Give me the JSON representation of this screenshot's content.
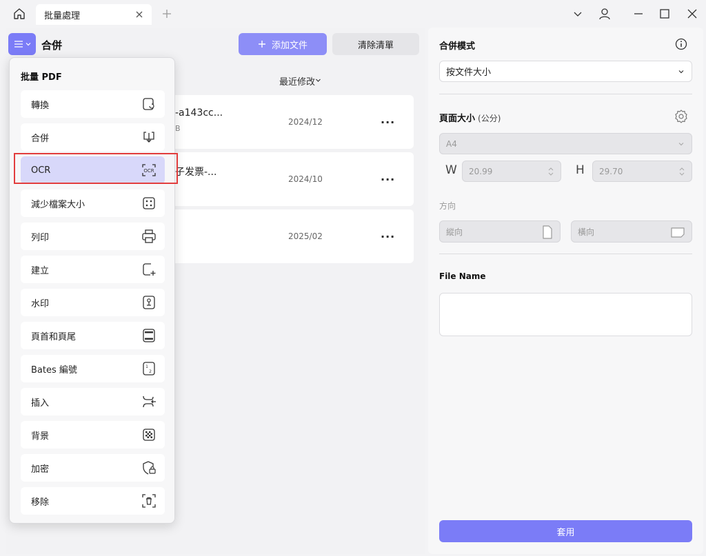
{
  "titlebar": {
    "tab_label": "批量處理"
  },
  "toolbar": {
    "panel_title": "合併",
    "add_files_label": "添加文件",
    "clear_list_label": "清除清單",
    "sort_label": "最近修改"
  },
  "files": [
    {
      "name": "-a143cc...",
      "size": "B",
      "date": "2024/12",
      "more": "···"
    },
    {
      "name": "子发票-...",
      "size": "",
      "date": "2024/10",
      "more": "···"
    },
    {
      "name": "",
      "size": "",
      "date": "2025/02",
      "more": "···"
    }
  ],
  "menu": {
    "heading": "批量 PDF",
    "items": [
      {
        "label": "轉換",
        "icon": "convert-icon"
      },
      {
        "label": "合併",
        "icon": "merge-icon"
      },
      {
        "label": "OCR",
        "icon": "ocr-icon"
      },
      {
        "label": "減少檔案大小",
        "icon": "compress-icon"
      },
      {
        "label": "列印",
        "icon": "print-icon"
      },
      {
        "label": "建立",
        "icon": "create-icon"
      },
      {
        "label": "水印",
        "icon": "watermark-icon"
      },
      {
        "label": "頁首和頁尾",
        "icon": "header-footer-icon"
      },
      {
        "label": "Bates 編號",
        "icon": "bates-number-icon"
      },
      {
        "label": "插入",
        "icon": "insert-icon"
      },
      {
        "label": "背景",
        "icon": "background-icon"
      },
      {
        "label": "加密",
        "icon": "encrypt-icon"
      },
      {
        "label": "移除",
        "icon": "remove-icon"
      }
    ],
    "active_item": "OCR"
  },
  "settings": {
    "merge_mode_label": "合併模式",
    "merge_mode_value": "按文件大小",
    "page_size_label": "頁面大小",
    "page_size_unit": "(公分)",
    "page_size_value": "A4",
    "width_label": "W",
    "width_value": "20.99",
    "height_label": "H",
    "height_value": "29.70",
    "orientation_label": "方向",
    "portrait_label": "縱向",
    "landscape_label": "橫向",
    "file_name_label": "File Name",
    "file_name_value": "",
    "apply_label": "套用"
  },
  "colors": {
    "accent": "#7b7cf7",
    "highlight": "#e23d3d"
  }
}
